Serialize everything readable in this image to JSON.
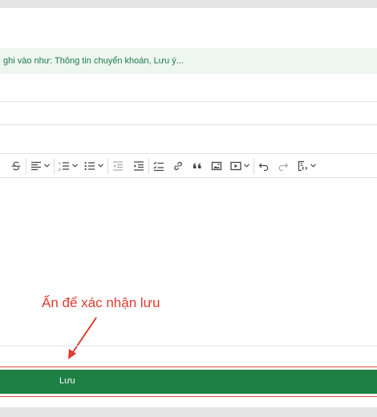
{
  "hint": {
    "text": "ghi vào như: Thông tin chuyển khoán, Lưu ý..."
  },
  "toolbar": {
    "items": [
      {
        "name": "strikethrough-icon"
      },
      {
        "name": "align-icon"
      },
      {
        "name": "numbered-list-icon"
      },
      {
        "name": "bulleted-list-icon"
      },
      {
        "name": "outdent-icon"
      },
      {
        "name": "indent-icon"
      },
      {
        "name": "todo-list-icon"
      },
      {
        "name": "link-icon"
      },
      {
        "name": "blockquote-icon"
      },
      {
        "name": "image-icon"
      },
      {
        "name": "media-icon"
      },
      {
        "name": "undo-icon"
      },
      {
        "name": "redo-icon"
      },
      {
        "name": "source-icon"
      }
    ]
  },
  "annotation": {
    "text": "Ấn để xác nhận lưu",
    "color": "#e03a2f"
  },
  "save": {
    "label": "Lưu",
    "color": "#1e8045"
  }
}
